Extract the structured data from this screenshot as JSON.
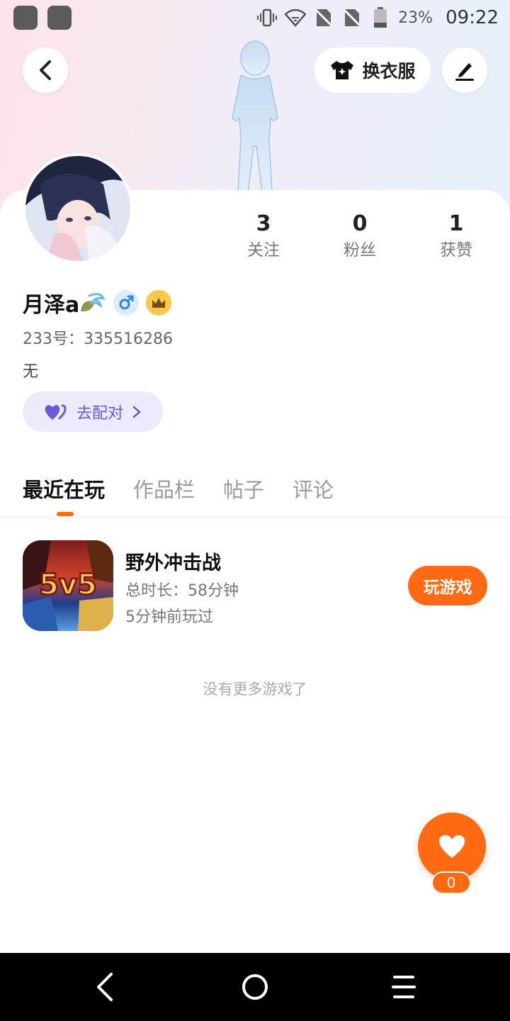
{
  "status_bar": {
    "battery_percent": "23%",
    "time": "09:22"
  },
  "header": {
    "outfit_label": "换衣服"
  },
  "stats": [
    {
      "value": "3",
      "label": "关注"
    },
    {
      "value": "0",
      "label": "粉丝"
    },
    {
      "value": "1",
      "label": "获赞"
    }
  ],
  "profile": {
    "name": "月泽a",
    "uid": "233号：335516286",
    "bio": "无",
    "gender_icon": "male-icon",
    "vip_icon": "crown-icon"
  },
  "match": {
    "label": "去配对"
  },
  "tabs": [
    {
      "label": "最近在玩",
      "active": true
    },
    {
      "label": "作品栏",
      "active": false
    },
    {
      "label": "帖子",
      "active": false
    },
    {
      "label": "评论",
      "active": false
    }
  ],
  "game": {
    "title": "野外冲击战",
    "icon_text": "5v5",
    "total_time": "总时长：58分钟",
    "last_played": "5分钟前玩过",
    "play_label": "玩游戏"
  },
  "list_footer": "没有更多游戏了",
  "like": {
    "count": "0"
  },
  "colors": {
    "accent": "#ff6a13",
    "match_bg": "#ecebfd",
    "match_text": "#6a58d8"
  }
}
